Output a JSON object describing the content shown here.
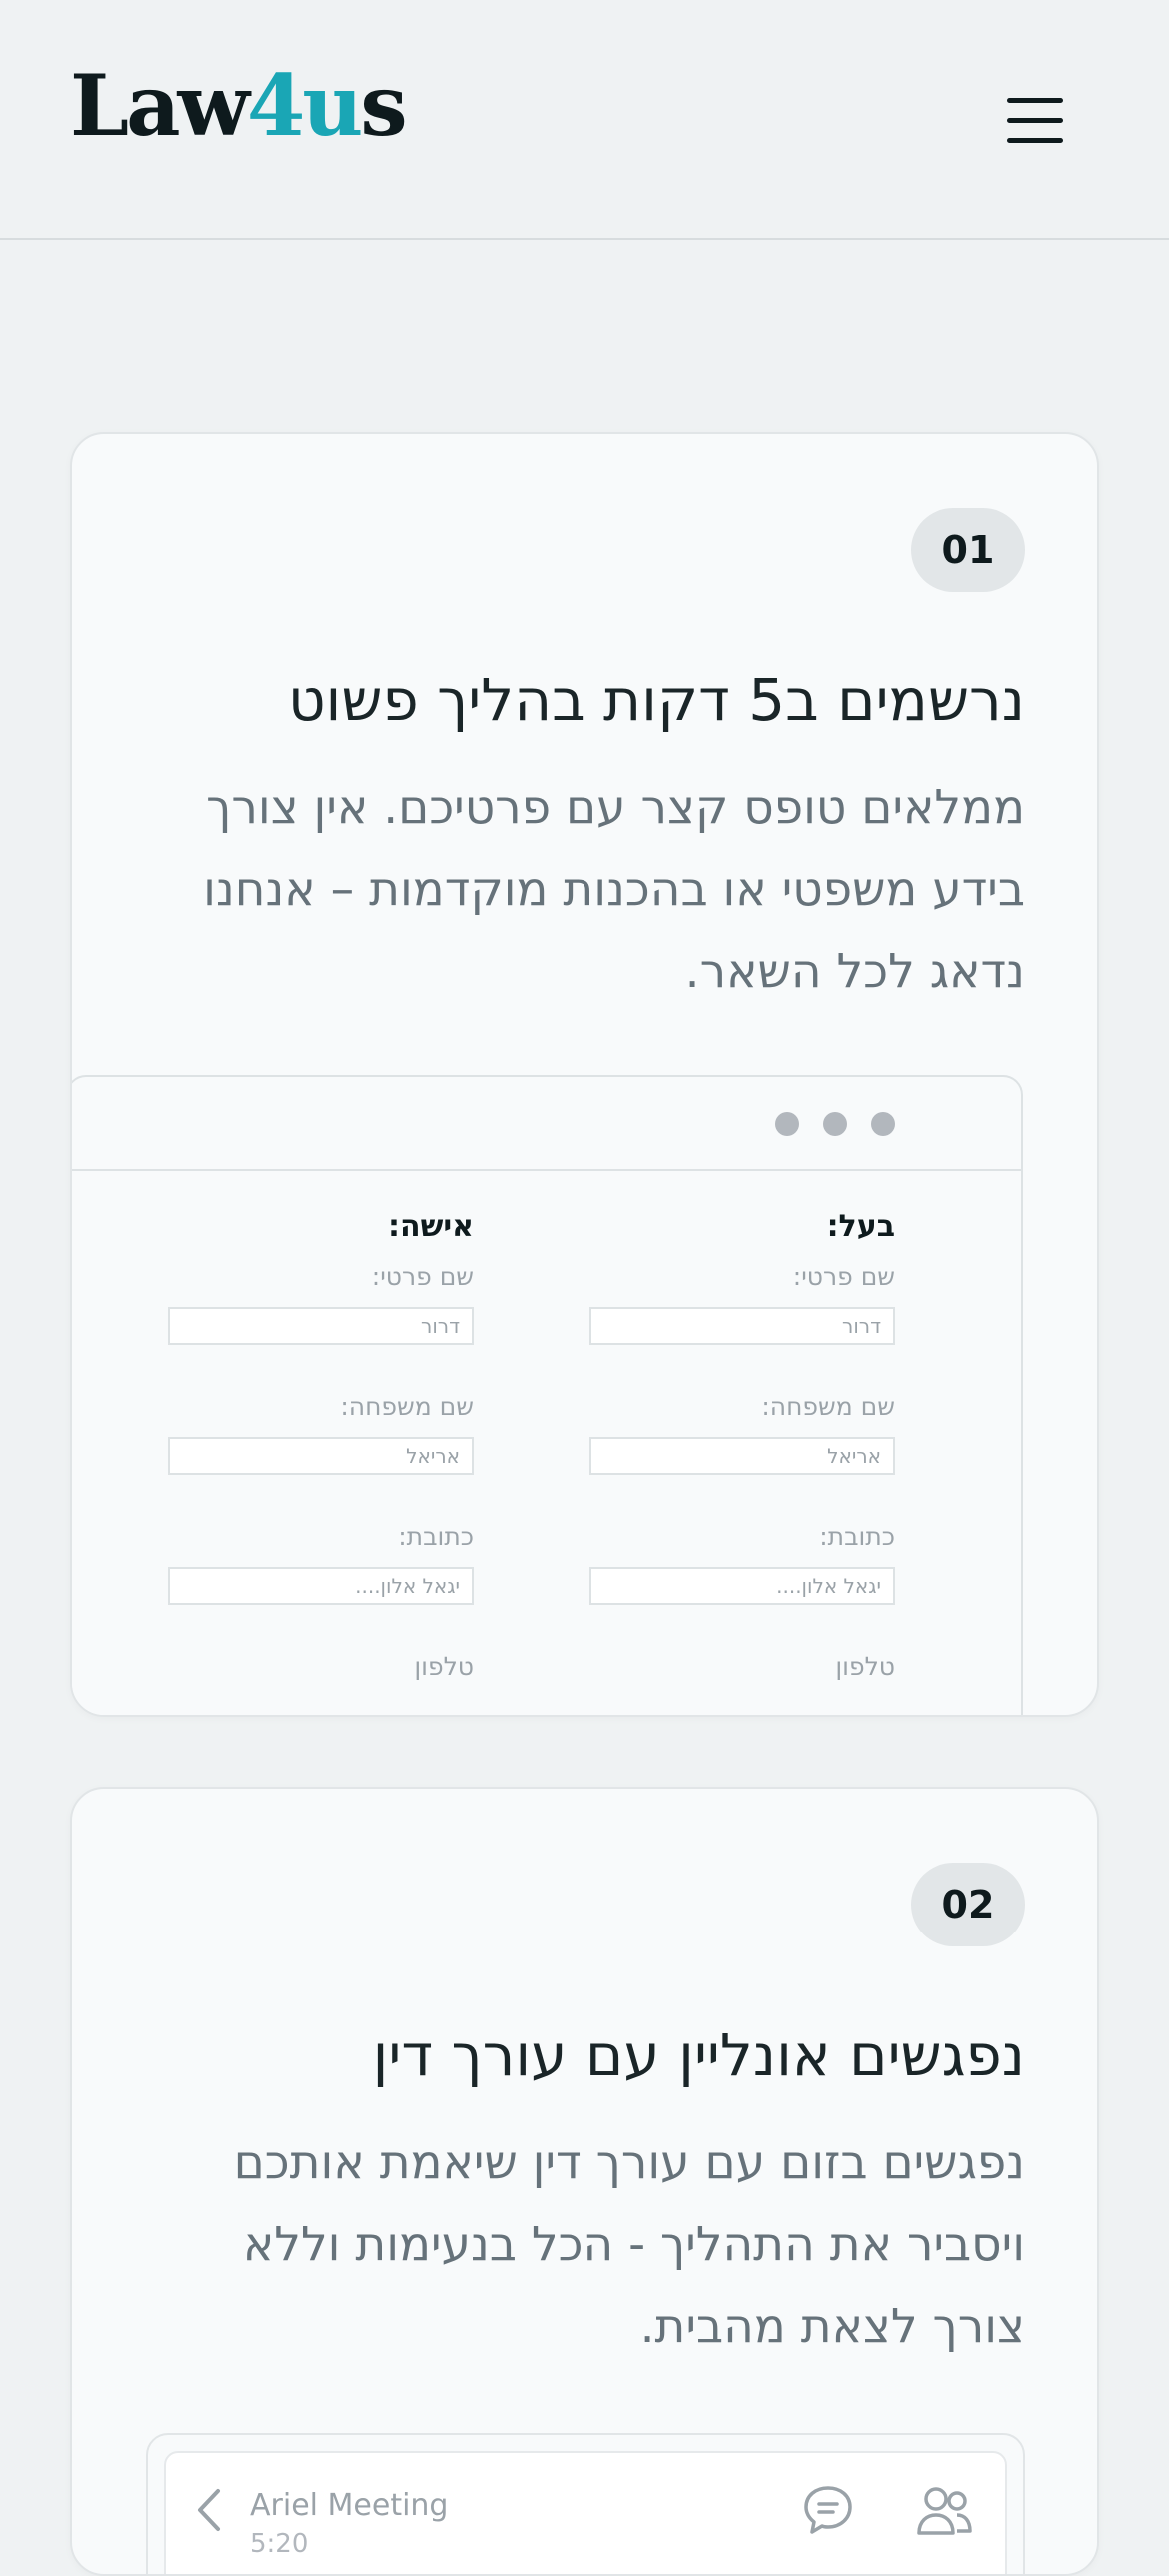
{
  "header": {
    "logo_pre": "Law",
    "logo_accent": "4u",
    "logo_post": "s"
  },
  "steps": [
    {
      "number": "01",
      "title": "נרשמים ב5 דקות בהליך פשוט",
      "description": "ממלאים טופס קצר עם פרטיכם. אין צורך בידע משפטי או בהכנות מוקדמות – אנחנו נדאג לכל השאר.",
      "form": {
        "husband": {
          "heading": "בעל:",
          "first_name_label": "שם פרטי:",
          "first_name_value": "דרור",
          "last_name_label": "שם משפחה:",
          "last_name_value": "אריאל",
          "address_label": "כתובת:",
          "address_value": "יגאל אלון....",
          "phone_label": "טלפון"
        },
        "wife": {
          "heading": "אישה:",
          "first_name_label": "שם פרטי:",
          "first_name_value": "דרור",
          "last_name_label": "שם משפחה:",
          "last_name_value": "אריאל",
          "address_label": "כתובת:",
          "address_value": "יגאל אלון....",
          "phone_label": "טלפון"
        }
      }
    },
    {
      "number": "02",
      "title": "נפגשים אונליין עם עורך דין",
      "description": "נפגשים בזום עם עורך דין שיאמת אותכם ויסביר את התהליך - הכל בנעימות וללא צורך לצאת מהבית.",
      "meeting": {
        "name": "Ariel Meeting",
        "time": "5:20"
      }
    }
  ]
}
